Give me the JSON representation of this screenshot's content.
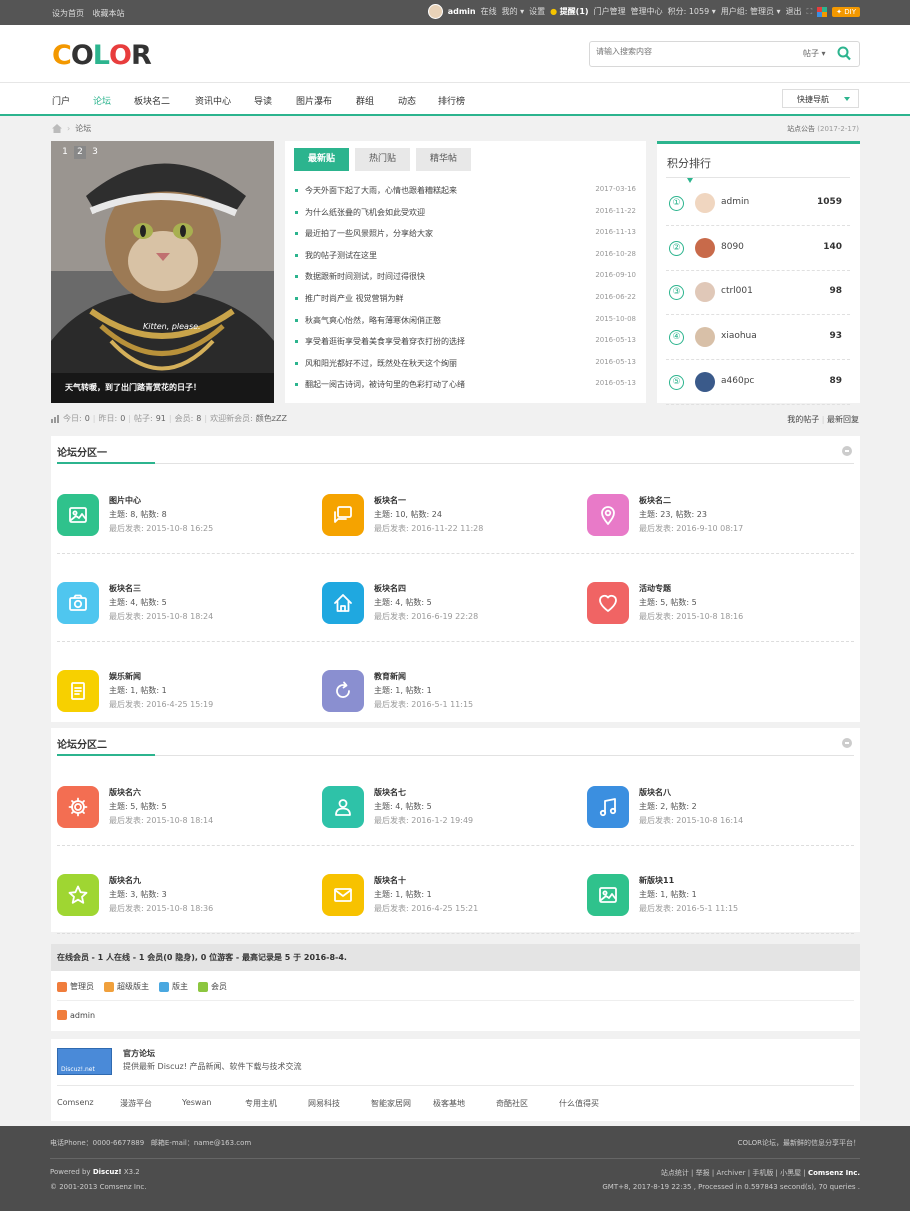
{
  "topbar": {
    "set_home": "设为首页",
    "bookmark": "收藏本站",
    "username": "admin",
    "online": "在线",
    "my": "我的",
    "settings": "设置",
    "reminder": "提醒(1)",
    "portal_manage": "门户管理",
    "manage_center": "管理中心",
    "points": "积分: 1059",
    "user_group": "用户组: 管理员",
    "logout": "退出",
    "diy": "DIY"
  },
  "logo": {
    "letters": [
      "C",
      "O",
      "L",
      "O",
      "R"
    ],
    "colors": [
      "#f39800",
      "#333333",
      "#2cb48e",
      "#e83d3d",
      "#333333"
    ]
  },
  "search": {
    "placeholder": "请输入搜索内容",
    "type": "帖子"
  },
  "nav": {
    "items": [
      "门户",
      "论坛",
      "板块名二",
      "资讯中心",
      "导读",
      "图片瀑布",
      "群组",
      "动态",
      "排行榜"
    ],
    "active_index": 1,
    "quick_nav": "快捷导航"
  },
  "breadcrumb": {
    "current": "论坛"
  },
  "notice": {
    "label": "站点公告",
    "date": "(2017-2-17)"
  },
  "slide": {
    "pages": [
      "1",
      "2",
      "3"
    ],
    "active": 1,
    "caption": "天气转暖，到了出门踏青赏花的日子！",
    "shirt_text": "Kitten, please."
  },
  "posts": {
    "tabs": [
      "最新贴",
      "热门贴",
      "精华帖"
    ],
    "items": [
      {
        "title": "今天外面下起了大雨，心情也跟着糟糕起来",
        "date": "2017-03-16"
      },
      {
        "title": "为什么纸张叠的飞机会如此受欢迎",
        "date": "2016-11-22"
      },
      {
        "title": "最近拍了一些风景照片，分享给大家",
        "date": "2016-11-13"
      },
      {
        "title": "我的帖子测试在这里",
        "date": "2016-10-28"
      },
      {
        "title": "数据跟新时间测试，时间过得很快",
        "date": "2016-09-10"
      },
      {
        "title": "推广时尚产业 视觉营销为鲜",
        "date": "2016-06-22"
      },
      {
        "title": "秋高气爽心怡然，略有薄寒休闲俏正憨",
        "date": "2015-10-08"
      },
      {
        "title": "享受着逛街享受着美食享受着穿衣打扮的选择",
        "date": "2016-05-13"
      },
      {
        "title": "风和阳光都好不过，既然处在秋天这个绚丽",
        "date": "2016-05-13"
      },
      {
        "title": "翻起一阅古诗词，被诗句里的色彩打动了心绪",
        "date": "2016-05-13"
      }
    ]
  },
  "rank": {
    "title": "积分排行",
    "items": [
      {
        "num": "①",
        "name": "admin",
        "score": "1059",
        "color": "#f0d6c0"
      },
      {
        "num": "②",
        "name": "8090",
        "score": "140",
        "color": "#c86a4a"
      },
      {
        "num": "③",
        "name": "ctrl001",
        "score": "98",
        "color": "#e0c8b8"
      },
      {
        "num": "④",
        "name": "xiaohua",
        "score": "93",
        "color": "#d8c0a8"
      },
      {
        "num": "⑤",
        "name": "a460pc",
        "score": "89",
        "color": "#3a5a8a"
      }
    ]
  },
  "stats": {
    "today_label": "今日:",
    "today": "0",
    "yesterday_label": "昨日:",
    "yesterday": "0",
    "posts_label": "帖子:",
    "posts": "91",
    "members_label": "会员:",
    "members": "8",
    "welcome": "欢迎新会员:",
    "new_member": "颜色zZZ",
    "my_posts": "我的帖子",
    "new_replies": "最新回复"
  },
  "section1": {
    "title": "论坛分区一",
    "forums": [
      {
        "name": "图片中心",
        "counts": "主题: 8, 帖数: 8",
        "last": "最后发表: 2015-10-8 16:25",
        "color": "#2fc28c",
        "icon": "image-icon"
      },
      {
        "name": "板块名一",
        "counts": "主题: 10, 帖数: 24",
        "last": "最后发表: 2016-11-22 11:28",
        "color": "#f5a300",
        "icon": "chat-icon"
      },
      {
        "name": "板块名二",
        "counts": "主题: 23, 帖数: 23",
        "last": "最后发表: 2016-9-10 08:17",
        "color": "#e87ac8",
        "icon": "location-icon"
      },
      {
        "name": "板块名三",
        "counts": "主题: 4, 帖数: 5",
        "last": "最后发表: 2015-10-8 18:24",
        "color": "#4fc6ef",
        "icon": "camera-icon"
      },
      {
        "name": "板块名四",
        "counts": "主题: 4, 帖数: 5",
        "last": "最后发表: 2016-6-19 22:28",
        "color": "#1fa8e0",
        "icon": "home-icon"
      },
      {
        "name": "活动专题",
        "counts": "主题: 5, 帖数: 5",
        "last": "最后发表: 2015-10-8 18:16",
        "color": "#f06464",
        "icon": "heart-icon"
      },
      {
        "name": "娱乐新闻",
        "counts": "主题: 1, 帖数: 1",
        "last": "最后发表: 2016-4-25 15:19",
        "color": "#f7d000",
        "icon": "document-icon"
      },
      {
        "name": "教育新闻",
        "counts": "主题: 1, 帖数: 1",
        "last": "最后发表: 2016-5-1 11:15",
        "color": "#8a8fd0",
        "icon": "refresh-icon"
      }
    ]
  },
  "section2": {
    "title": "论坛分区二",
    "forums": [
      {
        "name": "版块名六",
        "counts": "主题: 5, 帖数: 5",
        "last": "最后发表: 2015-10-8 18:14",
        "color": "#f36e52",
        "icon": "gear-icon"
      },
      {
        "name": "版块名七",
        "counts": "主题: 4, 帖数: 5",
        "last": "最后发表: 2016-1-2 19:49",
        "color": "#2ec2a8",
        "icon": "users-icon"
      },
      {
        "name": "版块名八",
        "counts": "主题: 2, 帖数: 2",
        "last": "最后发表: 2015-10-8 16:14",
        "color": "#3b8fe0",
        "icon": "music-icon"
      },
      {
        "name": "版块名九",
        "counts": "主题: 3, 帖数: 3",
        "last": "最后发表: 2015-10-8 18:36",
        "color": "#9fd632",
        "icon": "star-icon"
      },
      {
        "name": "版块名十",
        "counts": "主题: 1, 帖数: 1",
        "last": "最后发表: 2016-4-25 15:21",
        "color": "#f7c200",
        "icon": "mail-icon"
      },
      {
        "name": "新版块11",
        "counts": "主题: 1, 帖数: 1",
        "last": "最后发表: 2016-5-1 11:15",
        "color": "#2fc28c",
        "icon": "image-icon"
      }
    ]
  },
  "online": {
    "title": "在线会员",
    "summary": "- 1 人在线 - 1 会员(0 隐身), 0 位游客 - 最高记录是 5 于 2016-8-4.",
    "legend": [
      {
        "label": "管理员",
        "color": "#f07d3c"
      },
      {
        "label": "超级版主",
        "color": "#f0a03c"
      },
      {
        "label": "版主",
        "color": "#4aa8e0"
      },
      {
        "label": "会员",
        "color": "#8cc63f"
      }
    ],
    "member": "admin"
  },
  "links": {
    "logo_text": "Discuz!.net",
    "title": "官方论坛",
    "desc": "提供最新 Discuz! 产品新闻、软件下载与技术交流",
    "items": [
      "Comsenz",
      "漫游平台",
      "Yeswan",
      "专用主机",
      "网易科技",
      "智能家居网",
      "极客基地",
      "奇酷社区",
      "什么值得买"
    ]
  },
  "footer": {
    "phone": "电话Phone：0000-6677889",
    "email": "邮箱E-mail：name@163.com",
    "slogan": "COLOR论坛，最新鲜的信息分享平台！",
    "powered_prefix": "Powered by",
    "powered_brand": "Discuz!",
    "powered_version": "X3.2",
    "copyright": "© 2001-2013 Comsenz Inc.",
    "links": "站点统计 | 举报 | Archiver | 手机版 | 小黑屋 |",
    "company": "Comsenz Inc.",
    "runtime": "GMT+8, 2017-8-19 22:35 , Processed in 0.597843 second(s), 70 queries ."
  }
}
